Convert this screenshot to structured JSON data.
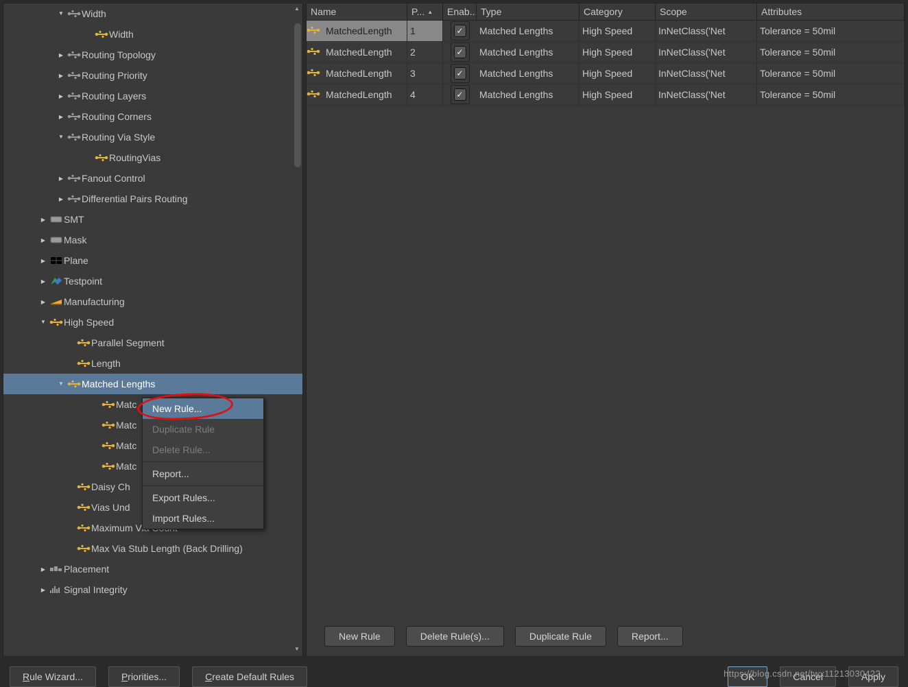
{
  "columns": {
    "name": "Name",
    "p": "P...",
    "enable": "Enab...",
    "type": "Type",
    "category": "Category",
    "scope": "Scope",
    "attributes": "Attributes"
  },
  "rows": [
    {
      "name": "MatchedLength",
      "p": "1",
      "type": "Matched Lengths",
      "category": "High Speed",
      "scope": "InNetClass('Net",
      "attr": "Tolerance = 50mil"
    },
    {
      "name": "MatchedLength",
      "p": "2",
      "type": "Matched Lengths",
      "category": "High Speed",
      "scope": "InNetClass('Net",
      "attr": "Tolerance = 50mil"
    },
    {
      "name": "MatchedLength",
      "p": "3",
      "type": "Matched Lengths",
      "category": "High Speed",
      "scope": "InNetClass('Net",
      "attr": "Tolerance = 50mil"
    },
    {
      "name": "MatchedLength",
      "p": "4",
      "type": "Matched Lengths",
      "category": "High Speed",
      "scope": "InNetClass('Net",
      "attr": "Tolerance = 50mil"
    }
  ],
  "tree": {
    "width": "Width",
    "width_child": "Width",
    "routing_topology": "Routing Topology",
    "routing_priority": "Routing Priority",
    "routing_layers": "Routing Layers",
    "routing_corners": "Routing Corners",
    "routing_via_style": "Routing Via Style",
    "routing_vias": "RoutingVias",
    "fanout_control": "Fanout Control",
    "diff_pairs": "Differential Pairs Routing",
    "smt": "SMT",
    "mask": "Mask",
    "plane": "Plane",
    "testpoint": "Testpoint",
    "manufacturing": "Manufacturing",
    "high_speed": "High Speed",
    "parallel_segment": "Parallel Segment",
    "length": "Length",
    "matched_lengths": "Matched Lengths",
    "matc1": "Matc",
    "matc2": "Matc",
    "matc3": "Matc",
    "matc4": "Matc",
    "daisy": "Daisy Ch",
    "vias_under": "Vias Und",
    "max_via_count": "Maximum Via Count",
    "max_via_stub": "Max Via Stub Length (Back Drilling)",
    "placement": "Placement",
    "signal_integrity": "Signal Integrity"
  },
  "context": {
    "new_rule": "New Rule...",
    "duplicate": "Duplicate Rule",
    "delete": "Delete Rule...",
    "report": "Report...",
    "export": "Export Rules...",
    "import": "Import Rules..."
  },
  "actions": {
    "new_rule": "New Rule",
    "delete_rules": "Delete Rule(s)...",
    "duplicate_rule": "Duplicate Rule",
    "report": "Report..."
  },
  "footer": {
    "rule_wizard_pre": "R",
    "rule_wizard": "ule Wizard...",
    "priorities_pre": "P",
    "priorities": "riorities...",
    "create_default_pre": "C",
    "create_default": "reate Default Rules",
    "ok": "OK",
    "cancel": "Cancel",
    "apply": "Apply"
  },
  "watermark": "https://blog.csdn.net/twx11213030422"
}
